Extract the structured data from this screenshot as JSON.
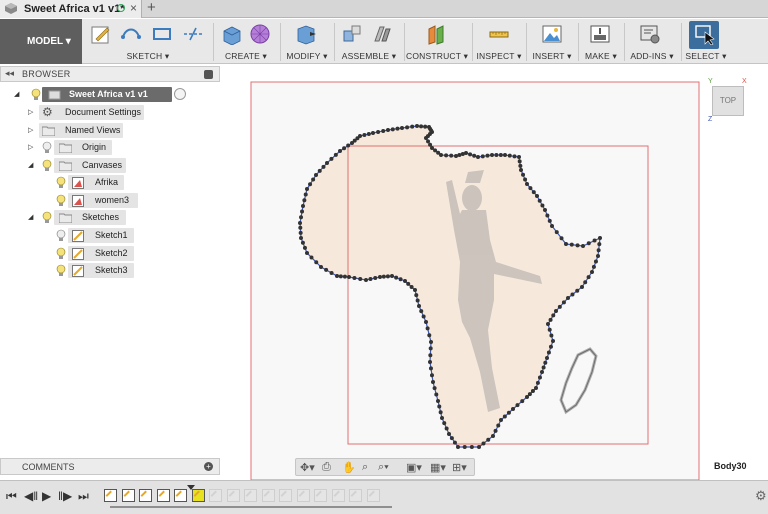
{
  "tab": {
    "title": "Sweet Africa v1 v1*",
    "close": "×",
    "new_tab": "+"
  },
  "toolbar": {
    "workspace": "MODEL ▾",
    "groups": [
      {
        "label": "SKETCH ▾"
      },
      {
        "label": "CREATE ▾"
      },
      {
        "label": "MODIFY ▾"
      },
      {
        "label": "ASSEMBLE ▾"
      },
      {
        "label": "CONSTRUCT ▾"
      },
      {
        "label": "INSPECT ▾"
      },
      {
        "label": "INSERT ▾"
      },
      {
        "label": "MAKE ▾"
      },
      {
        "label": "ADD-INS ▾"
      },
      {
        "label": "SELECT ▾"
      }
    ]
  },
  "browser": {
    "collapse": "◂◂",
    "title": "BROWSER",
    "root": "Sweet Africa v1 v1",
    "items": [
      {
        "label": "Document Settings"
      },
      {
        "label": "Named Views"
      },
      {
        "label": "Origin"
      },
      {
        "label": "Canvases"
      },
      {
        "label": "Afrika"
      },
      {
        "label": "women3"
      },
      {
        "label": "Sketches"
      },
      {
        "label": "Sketch1"
      },
      {
        "label": "Sketch2"
      },
      {
        "label": "Sketch3"
      }
    ]
  },
  "comments": {
    "title": "COMMENTS",
    "add": "+"
  },
  "viewcube": {
    "face": "TOP",
    "axis_x": "X",
    "axis_y": "Y",
    "axis_z": "Z"
  },
  "status": {
    "selection": "Body30"
  },
  "colors": {
    "accent": "#3c7bbd",
    "sketch_fill": "#f6e9dc",
    "canvas_border": "#e06060",
    "selected_tl": "#e7e21d"
  }
}
